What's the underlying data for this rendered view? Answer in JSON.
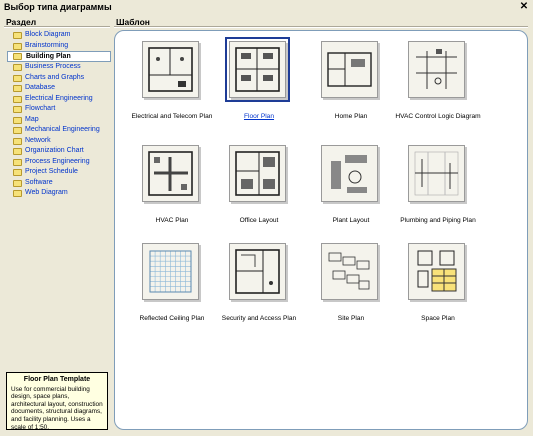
{
  "window": {
    "title": "Выбор типа диаграммы"
  },
  "left_header": "Раздел",
  "right_header": "Шаблон",
  "categories": [
    {
      "label": "Block Diagram"
    },
    {
      "label": "Brainstorming"
    },
    {
      "label": "Building Plan",
      "selected": true
    },
    {
      "label": "Business Process"
    },
    {
      "label": "Charts and Graphs"
    },
    {
      "label": "Database"
    },
    {
      "label": "Electrical Engineering"
    },
    {
      "label": "Flowchart"
    },
    {
      "label": "Map"
    },
    {
      "label": "Mechanical Engineering"
    },
    {
      "label": "Network"
    },
    {
      "label": "Organization Chart"
    },
    {
      "label": "Process Engineering"
    },
    {
      "label": "Project Schedule"
    },
    {
      "label": "Software"
    },
    {
      "label": "Web Diagram"
    }
  ],
  "templates": [
    {
      "label": "Electrical and Telecom Plan",
      "icon": "electrical-telecom-plan-icon"
    },
    {
      "label": "Floor Plan",
      "icon": "floor-plan-icon",
      "selected": true
    },
    {
      "label": "Home Plan",
      "icon": "home-plan-icon"
    },
    {
      "label": "HVAC Control Logic Diagram",
      "icon": "hvac-control-logic-icon"
    },
    {
      "label": "HVAC Plan",
      "icon": "hvac-plan-icon"
    },
    {
      "label": "Office Layout",
      "icon": "office-layout-icon"
    },
    {
      "label": "Plant Layout",
      "icon": "plant-layout-icon"
    },
    {
      "label": "Plumbing and Piping Plan",
      "icon": "plumbing-piping-icon"
    },
    {
      "label": "Reflected Ceiling Plan",
      "icon": "reflected-ceiling-icon"
    },
    {
      "label": "Security and Access Plan",
      "icon": "security-access-icon"
    },
    {
      "label": "Site Plan",
      "icon": "site-plan-icon"
    },
    {
      "label": "Space Plan",
      "icon": "space-plan-icon"
    }
  ],
  "description": {
    "title": "Floor Plan Template",
    "text": "Use for commercial building design, space plans, architectural layout, construction documents, structural diagrams, and facility planning. Uses a scale of 1:50."
  },
  "colors": {
    "link": "#0033CC",
    "selection": "#1E3C96",
    "tooltip_bg": "#FFFFE1",
    "dialog_bg": "#ECE9D8"
  }
}
